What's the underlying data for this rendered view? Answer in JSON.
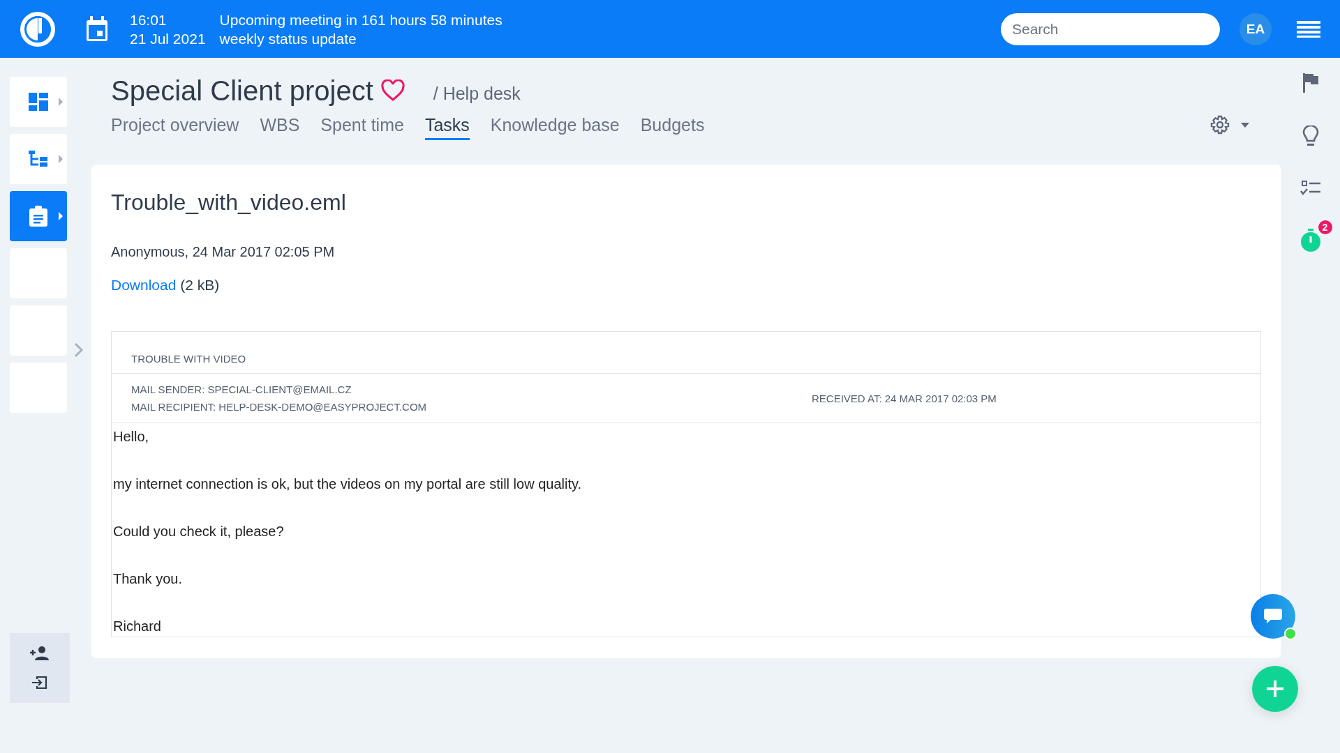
{
  "top_bar": {
    "time": "16:01",
    "meeting": "Upcoming meeting in 161 hours 58 minutes",
    "date": "21 Jul 2021",
    "meeting_title": "weekly status update",
    "search": {
      "placeholder": "Search"
    },
    "avatar": "EA"
  },
  "sidebar": {
    "items": [
      {
        "kind": "dashboard",
        "selected": false
      },
      {
        "kind": "tree",
        "selected": false
      },
      {
        "kind": "tasks",
        "selected": true
      },
      {
        "kind": "empty",
        "selected": false
      },
      {
        "kind": "empty",
        "selected": false
      },
      {
        "kind": "empty",
        "selected": false
      }
    ]
  },
  "project": {
    "title": "Special Client project",
    "breadcrumb": "/ Help desk",
    "tabs": [
      {
        "label": "Project overview",
        "selected": false
      },
      {
        "label": "WBS",
        "selected": false
      },
      {
        "label": "Spent time",
        "selected": false
      },
      {
        "label": "Tasks",
        "selected": true
      },
      {
        "label": "Knowledge base",
        "selected": false
      },
      {
        "label": "Budgets",
        "selected": false
      }
    ]
  },
  "attachment": {
    "filename": "Trouble_with_video.eml",
    "author_line": "Anonymous, 24 Mar 2017 02:05 PM",
    "download_link": "Download",
    "size": "(2 kB)"
  },
  "email": {
    "subject": "TROUBLE WITH VIDEO",
    "sender": "MAIL SENDER: SPECIAL-CLIENT@EMAIL.CZ",
    "recipient": "MAIL RECIPIENT: HELP-DESK-DEMO@EASYPROJECT.COM",
    "received": "RECEIVED AT: 24 MAR 2017 02:03 PM",
    "body": [
      "Hello,",
      "my internet connection is ok, but the videos on my portal are still low quality.",
      "Could you check it, please?",
      "Thank you.",
      "Richard"
    ]
  },
  "right_rail": {
    "timer_badge": "2"
  }
}
